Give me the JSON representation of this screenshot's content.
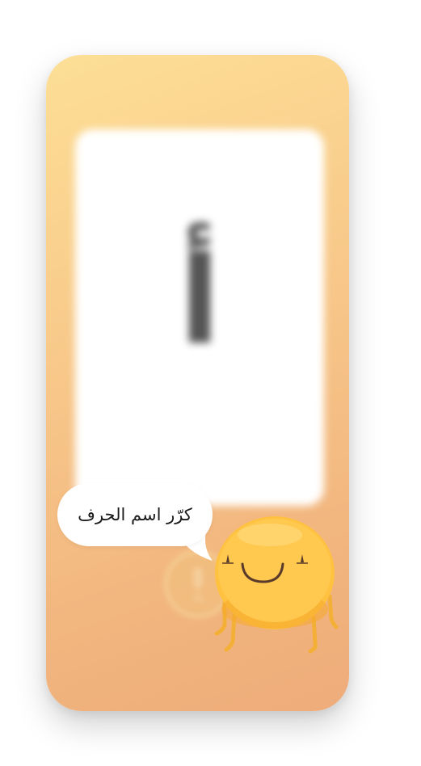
{
  "screen": {
    "card": {
      "letter": "أ"
    },
    "speech_bubble": {
      "text": "كرّر اسم الحرف"
    },
    "mic_button": {
      "icon": "microphone-icon"
    },
    "mascot": {
      "icon": "smiling-yellow-ball-mascot"
    }
  },
  "colors": {
    "background_top": "#fddf96",
    "background_bottom": "#eeac7a",
    "card": "#ffffff",
    "letter": "#555555",
    "mascot_body": "#ffc240",
    "mascot_outline": "#f6a92a"
  }
}
